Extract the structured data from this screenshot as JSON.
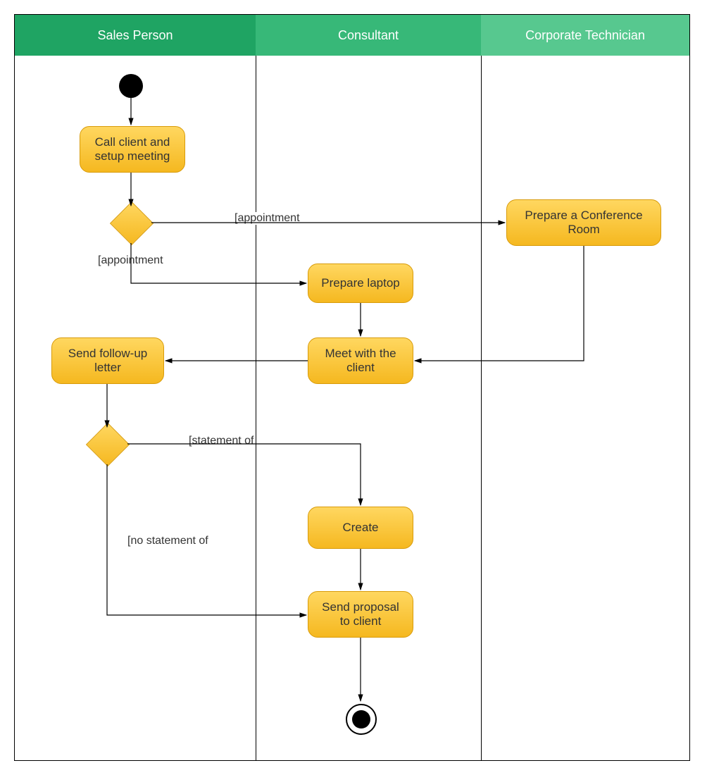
{
  "swimlanes": {
    "lane1": "Sales Person",
    "lane2": "Consultant",
    "lane3": "Corporate Technician"
  },
  "activities": {
    "call_client": "Call client and setup meeting",
    "prepare_conf": "Prepare a Conference Room",
    "prepare_laptop": "Prepare laptop",
    "meet_client": "Meet with the client",
    "follow_up": "Send follow-up letter",
    "create": "Create",
    "send_proposal": "Send proposal to client"
  },
  "edges": {
    "appointment1": "[appointment",
    "appointment2": "[appointment",
    "statement": "[statement of",
    "no_statement": "[no statement of"
  },
  "colors": {
    "lane1_header": "#1fa463",
    "lane2_header": "#37b878",
    "lane3_header": "#57c88f",
    "activity_fill": "#f5b820",
    "activity_border": "#d89b0a"
  }
}
